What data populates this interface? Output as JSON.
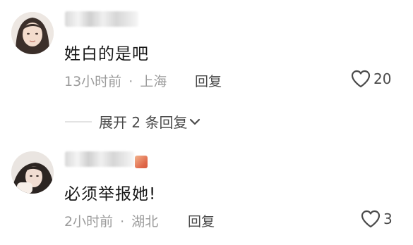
{
  "comments": [
    {
      "text": "姓白的是吧",
      "time": "13小时前",
      "sep": "·",
      "location": "上海",
      "reply_label": "回复",
      "likes": "20",
      "like_icon": "heart-outline-icon"
    },
    {
      "text": "必须举报她!",
      "time": "2小时前",
      "sep": "·",
      "location": "湖北",
      "reply_label": "回复",
      "likes": "3",
      "like_icon": "heart-outline-icon",
      "badge_color": "#e0684a"
    }
  ],
  "expand_replies": {
    "label": "展开 2 条回复",
    "icon": "chevron-down-icon"
  }
}
